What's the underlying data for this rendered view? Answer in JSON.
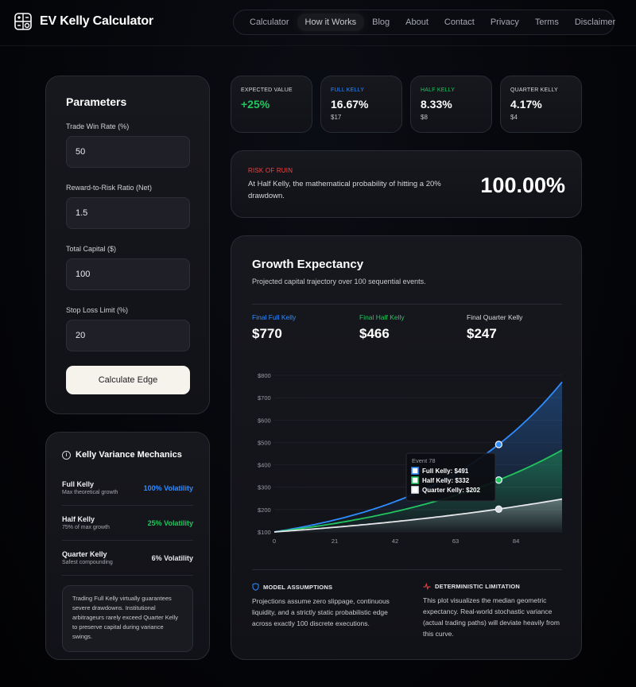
{
  "app": {
    "title": "EV Kelly Calculator",
    "logo_icon": "calculator-icon"
  },
  "nav": {
    "items": [
      {
        "label": "Calculator",
        "active": false
      },
      {
        "label": "How it Works",
        "active": true
      },
      {
        "label": "Blog",
        "active": false
      },
      {
        "label": "About",
        "active": false
      },
      {
        "label": "Contact",
        "active": false
      },
      {
        "label": "Privacy",
        "active": false
      },
      {
        "label": "Terms",
        "active": false
      },
      {
        "label": "Disclaimer",
        "active": false
      }
    ]
  },
  "parameters": {
    "title": "Parameters",
    "fields": [
      {
        "label": "Trade Win Rate (%)",
        "value": "50"
      },
      {
        "label": "Reward-to-Risk Ratio (Net)",
        "value": "1.5"
      },
      {
        "label": "Total Capital ($)",
        "value": "100"
      },
      {
        "label": "Stop Loss Limit (%)",
        "value": "20"
      }
    ],
    "button_label": "Calculate Edge"
  },
  "variance": {
    "title": "Kelly Variance Mechanics",
    "rows": [
      {
        "name": "Full Kelly",
        "sub": "Max theoretical growth",
        "value": "100% Volatility",
        "color": "#2f8cff"
      },
      {
        "name": "Half Kelly",
        "sub": "75% of max growth",
        "value": "25% Volatility",
        "color": "#22c55e"
      },
      {
        "name": "Quarter Kelly",
        "sub": "Safest compounding",
        "value": "6% Volatility",
        "color": "#e6e7eb"
      }
    ],
    "note": "Trading Full Kelly virtually guarantees severe drawdowns. Institutional arbitrageurs rarely exceed Quarter Kelly to preserve capital during variance swings."
  },
  "stats": [
    {
      "label": "EXPECTED VALUE",
      "value": "+25%",
      "sub": "",
      "label_color": "#d8d9de",
      "value_color": "#22c55e"
    },
    {
      "label": "FULL KELLY",
      "value": "16.67%",
      "sub": "$17",
      "label_color": "#2f8cff",
      "value_color": "#ffffff"
    },
    {
      "label": "HALF KELLY",
      "value": "8.33%",
      "sub": "$8",
      "label_color": "#22c55e",
      "value_color": "#ffffff"
    },
    {
      "label": "QUARTER KELLY",
      "value": "4.17%",
      "sub": "$4",
      "label_color": "#d8d9de",
      "value_color": "#ffffff"
    }
  ],
  "risk": {
    "label": "RISK OF RUIN",
    "text": "At Half Kelly, the mathematical probability of hitting a 20% drawdown.",
    "value": "100.00%"
  },
  "growth": {
    "title": "Growth Expectancy",
    "subtitle": "Projected capital trajectory over 100 sequential events.",
    "finals": [
      {
        "label": "Final Full Kelly",
        "value": "$770",
        "color": "#2f8cff"
      },
      {
        "label": "Final Half Kelly",
        "value": "$466",
        "color": "#22c55e"
      },
      {
        "label": "Final Quarter Kelly",
        "value": "$247",
        "color": "#d8d9de"
      }
    ],
    "notes": [
      {
        "icon": "shield-icon",
        "title": "MODEL ASSUMPTIONS",
        "text": "Projections assume zero slippage, continuous liquidity, and a strictly static probabilistic edge across exactly 100 discrete executions.",
        "icon_color": "#2f8cff"
      },
      {
        "icon": "pulse-icon",
        "title": "DETERMINISTIC LIMITATION",
        "text": "This plot visualizes the median geometric expectancy. Real-world stochastic variance (actual trading paths) will deviate heavily from this curve.",
        "icon_color": "#ef4444"
      }
    ]
  },
  "chart_data": {
    "type": "area",
    "x_ticks": [
      0,
      21,
      42,
      63,
      84
    ],
    "y_ticks": [
      "$100",
      "$200",
      "$300",
      "$400",
      "$500",
      "$600",
      "$700",
      "$800"
    ],
    "xlim": [
      0,
      100
    ],
    "ylim": [
      100,
      800
    ],
    "grid": true,
    "series": [
      {
        "name": "Full Kelly",
        "color": "#2f8cff",
        "start": 100,
        "end": 770
      },
      {
        "name": "Half Kelly",
        "color": "#22c55e",
        "start": 100,
        "end": 466
      },
      {
        "name": "Quarter Kelly",
        "color": "#e6e7eb",
        "start": 100,
        "end": 247
      }
    ],
    "tooltip": {
      "title": "Event 78",
      "x": 78,
      "items": [
        {
          "label": "Full Kelly: $491",
          "value": 491,
          "color": "#2f8cff"
        },
        {
          "label": "Half Kelly: $332",
          "value": 332,
          "color": "#22c55e"
        },
        {
          "label": "Quarter Kelly: $202",
          "value": 202,
          "color": "#e6e7eb"
        }
      ]
    }
  }
}
